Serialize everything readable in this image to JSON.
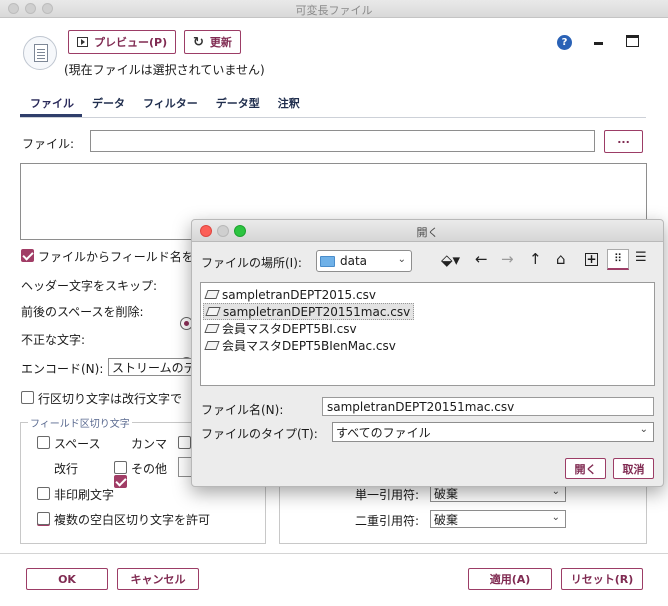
{
  "window": {
    "title": "可変長ファイル"
  },
  "toolbar": {
    "preview_label": "プレビュー(P)",
    "refresh_label": "更新"
  },
  "status": "(現在ファイルは選択されていません)",
  "tabs": [
    {
      "label": "ファイル",
      "active": true
    },
    {
      "label": "データ"
    },
    {
      "label": "フィルター"
    },
    {
      "label": "データ型"
    },
    {
      "label": "注釈"
    }
  ],
  "file": {
    "label": "ファイル:",
    "value": "",
    "browse_label": "..."
  },
  "options": {
    "read_field_names_label": "ファイルからフィールド名を",
    "header_skip_label": "ヘッダー文字をスキップ:",
    "trim_spaces_label": "前後のスペースを削除:",
    "invalid_chars_label": "不正な文字:",
    "encoding_label": "エンコード(N):",
    "encoding_value": "ストリームのデ",
    "line_delimiter_label": "行区切り文字は改行文字で"
  },
  "field_delimiters": {
    "title": "フィールド区切り文字",
    "space_label": "スペース",
    "comma_label": "カンマ",
    "newline_label": "改行",
    "other_label": "その他",
    "nonprinting_label": "非印刷文字",
    "multi_blank_label": "複数の空白区切り文字を許可"
  },
  "quotes": {
    "single_label": "単一引用符:",
    "single_value": "破棄",
    "double_label": "二重引用符:",
    "double_value": "破棄"
  },
  "footer": {
    "ok_label": "OK",
    "cancel_label": "キャンセル",
    "apply_label": "適用(A)",
    "reset_label": "リセット(R)"
  },
  "dialog": {
    "title": "開く",
    "location_label": "ファイルの場所(I):",
    "location_value": "data",
    "files": [
      {
        "name": "sampletranDEPT2015.csv",
        "selected": false
      },
      {
        "name": "sampletranDEPT20151mac.csv",
        "selected": true
      },
      {
        "name": "会員マスタDEPT5BI.csv",
        "selected": false
      },
      {
        "name": "会員マスタDEPT5BIenMac.csv",
        "selected": false
      }
    ],
    "filename_label": "ファイル名(N):",
    "filename_value": "sampletranDEPT20151mac.csv",
    "filetype_label": "ファイルのタイプ(T):",
    "filetype_value": "すべてのファイル",
    "open_label": "開く",
    "cancel_label": "取消"
  },
  "colors": {
    "accent": "#9c3d66",
    "tab_active": "#2f3e6a"
  }
}
